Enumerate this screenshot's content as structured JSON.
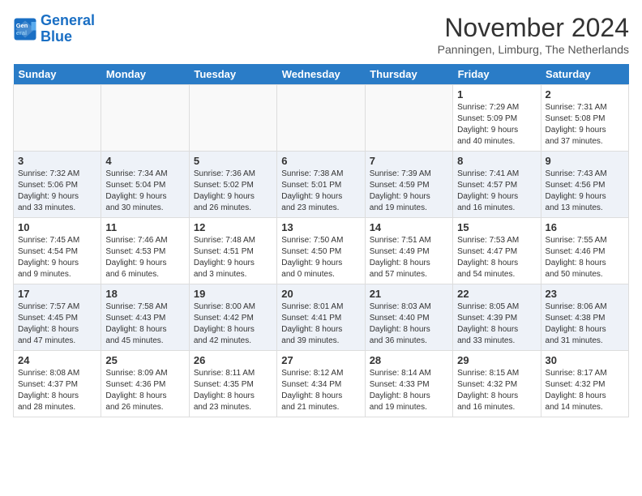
{
  "header": {
    "logo_general": "General",
    "logo_blue": "Blue",
    "month_title": "November 2024",
    "subtitle": "Panningen, Limburg, The Netherlands"
  },
  "days_of_week": [
    "Sunday",
    "Monday",
    "Tuesday",
    "Wednesday",
    "Thursday",
    "Friday",
    "Saturday"
  ],
  "weeks": [
    {
      "alt": false,
      "days": [
        {
          "num": "",
          "info": ""
        },
        {
          "num": "",
          "info": ""
        },
        {
          "num": "",
          "info": ""
        },
        {
          "num": "",
          "info": ""
        },
        {
          "num": "",
          "info": ""
        },
        {
          "num": "1",
          "info": "Sunrise: 7:29 AM\nSunset: 5:09 PM\nDaylight: 9 hours\nand 40 minutes."
        },
        {
          "num": "2",
          "info": "Sunrise: 7:31 AM\nSunset: 5:08 PM\nDaylight: 9 hours\nand 37 minutes."
        }
      ]
    },
    {
      "alt": true,
      "days": [
        {
          "num": "3",
          "info": "Sunrise: 7:32 AM\nSunset: 5:06 PM\nDaylight: 9 hours\nand 33 minutes."
        },
        {
          "num": "4",
          "info": "Sunrise: 7:34 AM\nSunset: 5:04 PM\nDaylight: 9 hours\nand 30 minutes."
        },
        {
          "num": "5",
          "info": "Sunrise: 7:36 AM\nSunset: 5:02 PM\nDaylight: 9 hours\nand 26 minutes."
        },
        {
          "num": "6",
          "info": "Sunrise: 7:38 AM\nSunset: 5:01 PM\nDaylight: 9 hours\nand 23 minutes."
        },
        {
          "num": "7",
          "info": "Sunrise: 7:39 AM\nSunset: 4:59 PM\nDaylight: 9 hours\nand 19 minutes."
        },
        {
          "num": "8",
          "info": "Sunrise: 7:41 AM\nSunset: 4:57 PM\nDaylight: 9 hours\nand 16 minutes."
        },
        {
          "num": "9",
          "info": "Sunrise: 7:43 AM\nSunset: 4:56 PM\nDaylight: 9 hours\nand 13 minutes."
        }
      ]
    },
    {
      "alt": false,
      "days": [
        {
          "num": "10",
          "info": "Sunrise: 7:45 AM\nSunset: 4:54 PM\nDaylight: 9 hours\nand 9 minutes."
        },
        {
          "num": "11",
          "info": "Sunrise: 7:46 AM\nSunset: 4:53 PM\nDaylight: 9 hours\nand 6 minutes."
        },
        {
          "num": "12",
          "info": "Sunrise: 7:48 AM\nSunset: 4:51 PM\nDaylight: 9 hours\nand 3 minutes."
        },
        {
          "num": "13",
          "info": "Sunrise: 7:50 AM\nSunset: 4:50 PM\nDaylight: 9 hours\nand 0 minutes."
        },
        {
          "num": "14",
          "info": "Sunrise: 7:51 AM\nSunset: 4:49 PM\nDaylight: 8 hours\nand 57 minutes."
        },
        {
          "num": "15",
          "info": "Sunrise: 7:53 AM\nSunset: 4:47 PM\nDaylight: 8 hours\nand 54 minutes."
        },
        {
          "num": "16",
          "info": "Sunrise: 7:55 AM\nSunset: 4:46 PM\nDaylight: 8 hours\nand 50 minutes."
        }
      ]
    },
    {
      "alt": true,
      "days": [
        {
          "num": "17",
          "info": "Sunrise: 7:57 AM\nSunset: 4:45 PM\nDaylight: 8 hours\nand 47 minutes."
        },
        {
          "num": "18",
          "info": "Sunrise: 7:58 AM\nSunset: 4:43 PM\nDaylight: 8 hours\nand 45 minutes."
        },
        {
          "num": "19",
          "info": "Sunrise: 8:00 AM\nSunset: 4:42 PM\nDaylight: 8 hours\nand 42 minutes."
        },
        {
          "num": "20",
          "info": "Sunrise: 8:01 AM\nSunset: 4:41 PM\nDaylight: 8 hours\nand 39 minutes."
        },
        {
          "num": "21",
          "info": "Sunrise: 8:03 AM\nSunset: 4:40 PM\nDaylight: 8 hours\nand 36 minutes."
        },
        {
          "num": "22",
          "info": "Sunrise: 8:05 AM\nSunset: 4:39 PM\nDaylight: 8 hours\nand 33 minutes."
        },
        {
          "num": "23",
          "info": "Sunrise: 8:06 AM\nSunset: 4:38 PM\nDaylight: 8 hours\nand 31 minutes."
        }
      ]
    },
    {
      "alt": false,
      "days": [
        {
          "num": "24",
          "info": "Sunrise: 8:08 AM\nSunset: 4:37 PM\nDaylight: 8 hours\nand 28 minutes."
        },
        {
          "num": "25",
          "info": "Sunrise: 8:09 AM\nSunset: 4:36 PM\nDaylight: 8 hours\nand 26 minutes."
        },
        {
          "num": "26",
          "info": "Sunrise: 8:11 AM\nSunset: 4:35 PM\nDaylight: 8 hours\nand 23 minutes."
        },
        {
          "num": "27",
          "info": "Sunrise: 8:12 AM\nSunset: 4:34 PM\nDaylight: 8 hours\nand 21 minutes."
        },
        {
          "num": "28",
          "info": "Sunrise: 8:14 AM\nSunset: 4:33 PM\nDaylight: 8 hours\nand 19 minutes."
        },
        {
          "num": "29",
          "info": "Sunrise: 8:15 AM\nSunset: 4:32 PM\nDaylight: 8 hours\nand 16 minutes."
        },
        {
          "num": "30",
          "info": "Sunrise: 8:17 AM\nSunset: 4:32 PM\nDaylight: 8 hours\nand 14 minutes."
        }
      ]
    }
  ]
}
